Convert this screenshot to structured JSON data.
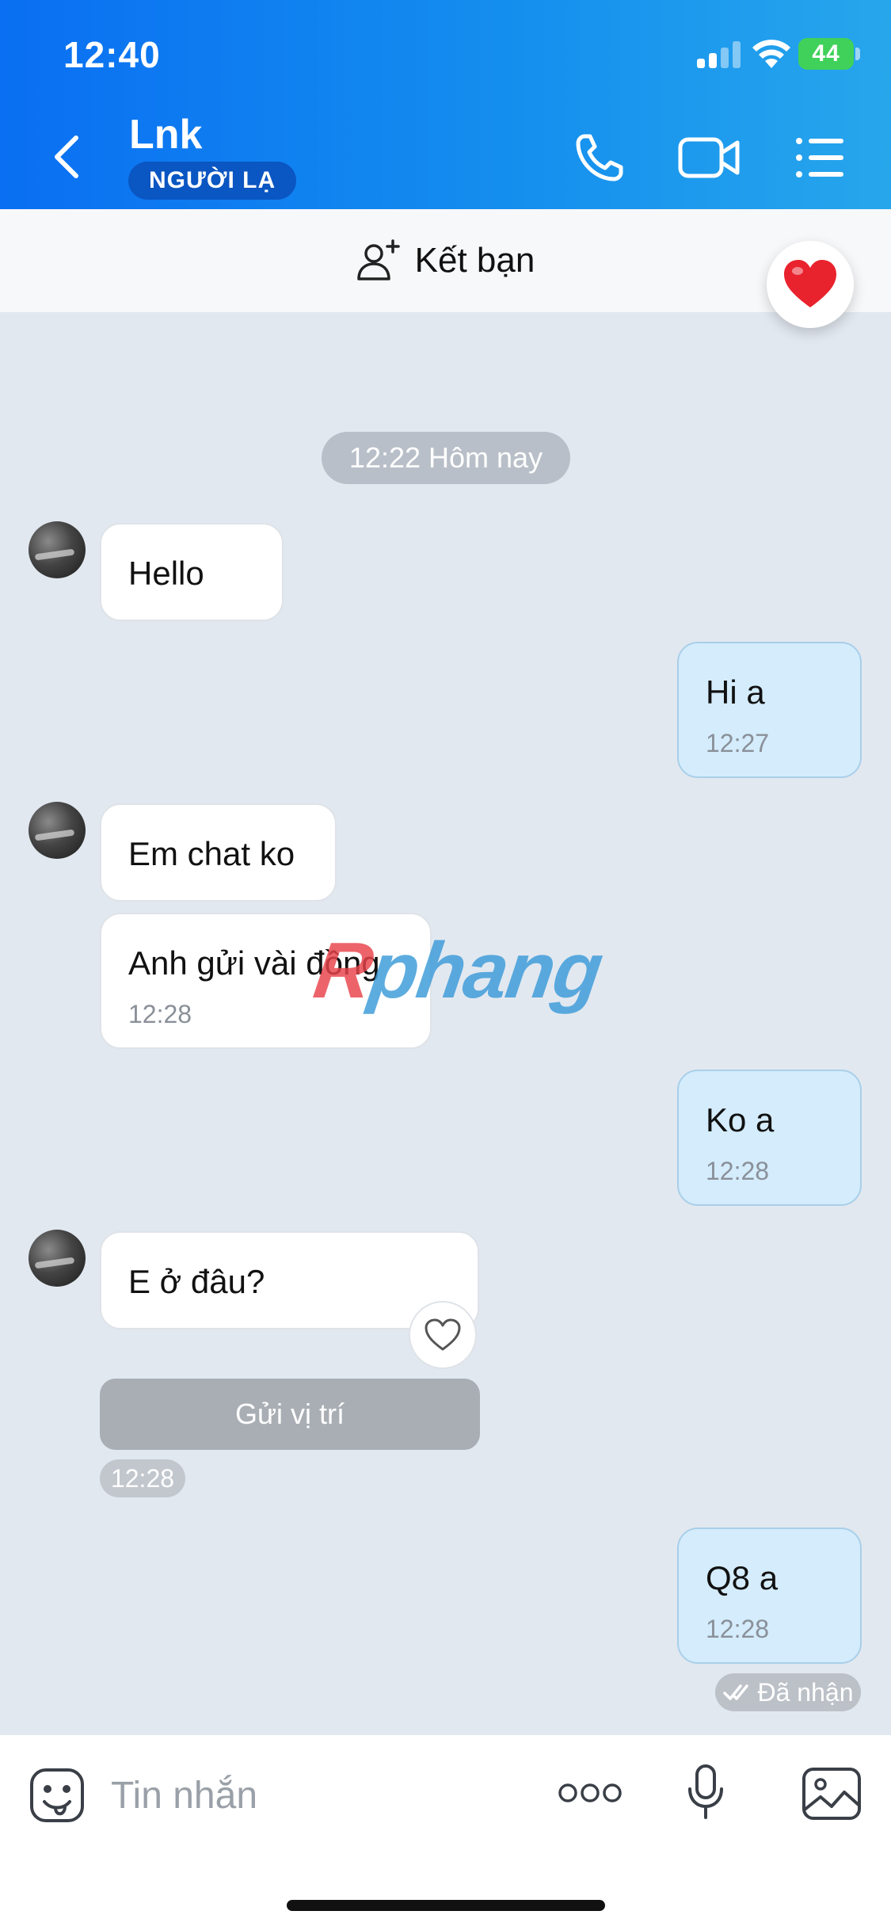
{
  "status_bar": {
    "time": "12:40",
    "battery": "44"
  },
  "header": {
    "title": "Lnk",
    "badge": "NGƯỜI LẠ"
  },
  "friend_bar": {
    "label": "Kết bạn"
  },
  "date_chip": "12:22 Hôm nay",
  "messages": [
    {
      "dir": "in",
      "text": "Hello",
      "time": ""
    },
    {
      "dir": "out",
      "text": "Hi a",
      "time": "12:27"
    },
    {
      "dir": "in",
      "text": "Em chat ko",
      "time": ""
    },
    {
      "dir": "in",
      "text": "Anh gửi vài đồng",
      "time": "12:28"
    },
    {
      "dir": "out",
      "text": "Ko a",
      "time": "12:28"
    },
    {
      "dir": "in",
      "text": "E ở đâu?",
      "time": ""
    },
    {
      "dir": "out",
      "text": "Q8 a",
      "time": "12:28"
    }
  ],
  "location_button": "Gửi vị trí",
  "location_time": "12:28",
  "received_status": "Đã nhận",
  "watermark": {
    "first": "R",
    "rest": "phang"
  },
  "input": {
    "placeholder": "Tin nhắn"
  },
  "colors": {
    "header_start": "#0a6ff2",
    "header_end": "#27a6ec",
    "outgoing_bubble": "#d4ecfc",
    "chat_bg": "#e2e8f0"
  }
}
